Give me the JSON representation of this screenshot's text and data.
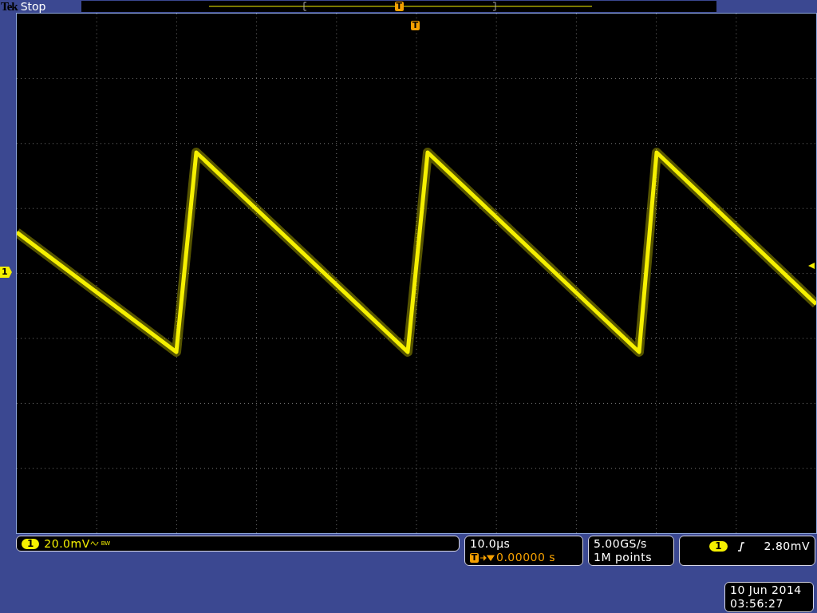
{
  "header": {
    "brand": "Tek",
    "status": "Stop"
  },
  "record_view": {
    "trigger_marker": "T"
  },
  "graticule": {
    "trigger_marker": "T",
    "channel_marker": "1"
  },
  "channel": {
    "number": "1",
    "scale": "20.0mV",
    "bw_label": "BW"
  },
  "timebase": {
    "scale": "10.0µs",
    "trigger_marker": "T",
    "position": "0.00000 s"
  },
  "acquisition": {
    "sample_rate": "5.00GS/s",
    "record_length": "1M points"
  },
  "trigger": {
    "source": "1",
    "level": "2.80mV"
  },
  "timestamp": {
    "date": "10 Jun 2014",
    "time": "03:56:27"
  }
}
